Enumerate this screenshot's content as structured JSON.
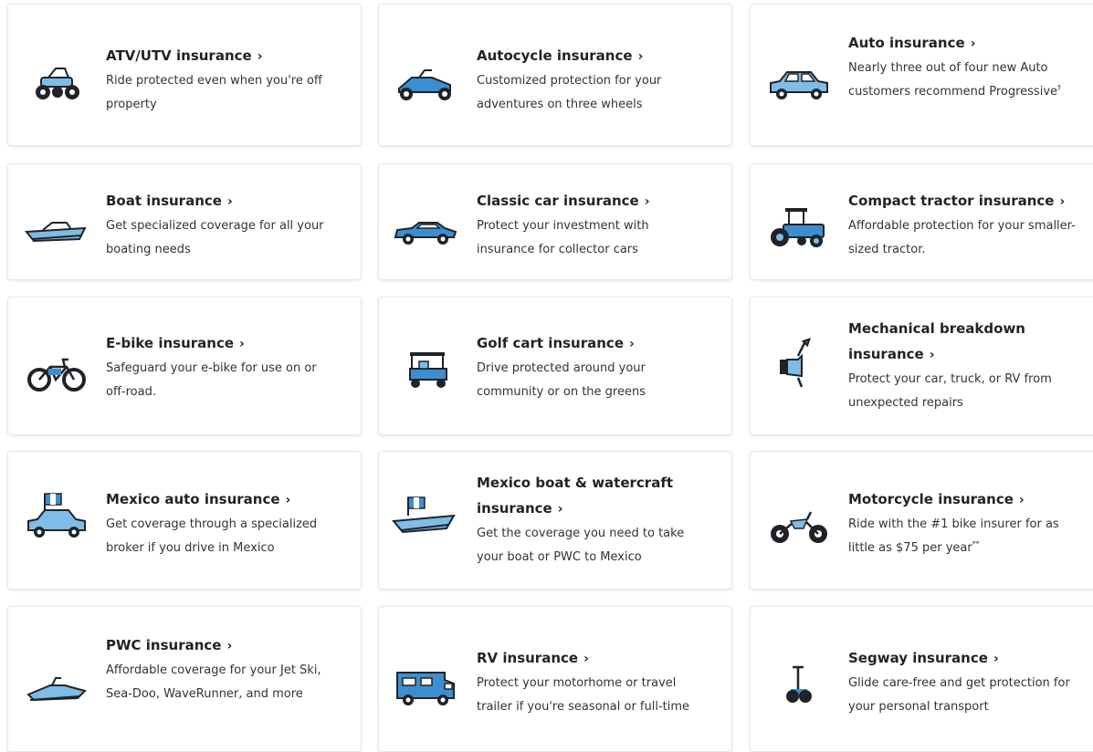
{
  "colors": {
    "accent_blue": "#3b8fd1",
    "icon_light_blue": "#7fbce6",
    "icon_dark": "#1f2328",
    "card_border": "#e4e7ea"
  },
  "cards": [
    {
      "title": "ATV/UTV insurance",
      "chevron": "›",
      "desc": "Ride protected even when you're off property",
      "icon": "atv-icon"
    },
    {
      "title": "Autocycle insurance",
      "chevron": "›",
      "desc": "Customized protection for your adventures on three wheels",
      "icon": "autocycle-icon"
    },
    {
      "title": "Auto insurance",
      "chevron": "›",
      "desc": "Nearly three out of four new Auto customers recommend Progressive",
      "sup": "†",
      "icon": "car-icon"
    },
    {
      "title": "Boat insurance",
      "chevron": "›",
      "desc": "Get specialized coverage for all your boating needs",
      "icon": "boat-icon"
    },
    {
      "title": "Classic car insurance",
      "chevron": "›",
      "desc": "Protect your investment with insurance for collector cars",
      "icon": "classic-car-icon"
    },
    {
      "title": "Compact tractor insurance",
      "chevron": "›",
      "desc": "Affordable protection for your smaller-sized tractor.",
      "icon": "tractor-icon"
    },
    {
      "title": "E-bike insurance",
      "chevron": "›",
      "desc": "Safeguard your e-bike for use on or off-road.",
      "icon": "ebike-icon"
    },
    {
      "title": "Golf cart insurance",
      "chevron": "›",
      "desc": "Drive protected around your community or on the greens",
      "icon": "golf-cart-icon"
    },
    {
      "title": "Mechanical breakdown insurance",
      "chevron": "›",
      "desc": "Protect your car, truck, or RV from unexpected repairs",
      "icon": "wrench-hand-icon"
    },
    {
      "title": "Mexico auto insurance",
      "chevron": "›",
      "desc": "Get coverage through a specialized broker if you drive in Mexico",
      "icon": "mexico-car-icon"
    },
    {
      "title": "Mexico boat & watercraft insurance",
      "chevron": "›",
      "desc": "Get the coverage you need to take your boat or PWC to Mexico",
      "icon": "mexico-boat-icon"
    },
    {
      "title": "Motorcycle insurance",
      "chevron": "›",
      "desc": "Ride with the #1 bike insurer for as little as $75 per year",
      "sup": "**",
      "icon": "motorcycle-icon"
    },
    {
      "title": "PWC insurance",
      "chevron": "›",
      "desc": "Affordable coverage for your Jet Ski, Sea-Doo, WaveRunner, and more",
      "icon": "jetski-icon"
    },
    {
      "title": "RV insurance",
      "chevron": "›",
      "desc": "Protect your motorhome or travel trailer if you're seasonal or full-time",
      "icon": "rv-icon"
    },
    {
      "title": "Segway insurance",
      "chevron": "›",
      "desc": "Glide care-free and get protection for your personal transport",
      "icon": "segway-icon"
    }
  ]
}
